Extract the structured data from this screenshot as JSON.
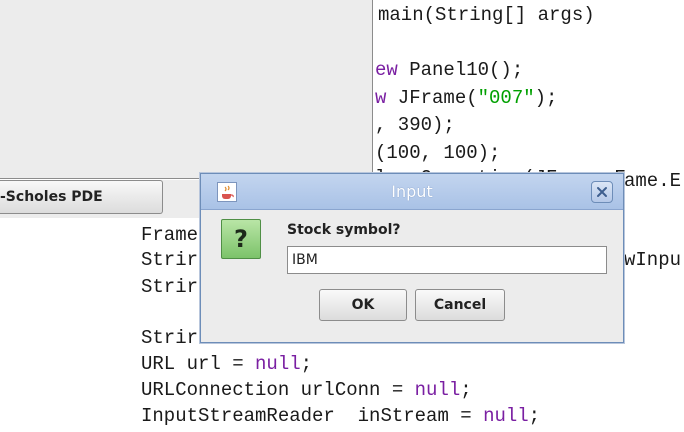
{
  "editor": {
    "lines": [
      {
        "plain": "main(String[] args)"
      },
      {
        "kw": "ew",
        "plain": " Panel10();"
      },
      {
        "kw": "w",
        "plain": " JFrame(",
        "str": "\"007\"",
        "tail": ");"
      },
      {
        "plain": ", 390);"
      },
      {
        "plain": "(100, 100);"
      },
      {
        "plain": "loseOperation(JFrame.E"
      },
      {
        "plain": "ame.E"
      },
      {
        "plain": "Frame"
      },
      {
        "plain": "Strir"
      },
      {
        "plain": "wInpu"
      },
      {
        "plain": "Strir"
      },
      {
        "plain": "Strir"
      },
      {
        "plain": "URL url = ",
        "kw": "null",
        "tail": ";"
      },
      {
        "plain": "URLConnection urlConn = ",
        "kw": "null",
        "tail": ";"
      },
      {
        "plain": "InputStreamReader  inStream = ",
        "kw": "null",
        "tail": ";"
      }
    ]
  },
  "background_button": {
    "label": "-Scholes PDE"
  },
  "dialog": {
    "title": "Input",
    "icon": "question-icon",
    "icon_glyph": "?",
    "prompt": "Stock symbol?",
    "input_value": "IBM",
    "ok_label": "OK",
    "cancel_label": "Cancel"
  },
  "colors": {
    "keyword": "#7a1fa2",
    "string": "#00a000",
    "titlebar": "#b4c9e9",
    "dialog_bg": "#ececec"
  }
}
